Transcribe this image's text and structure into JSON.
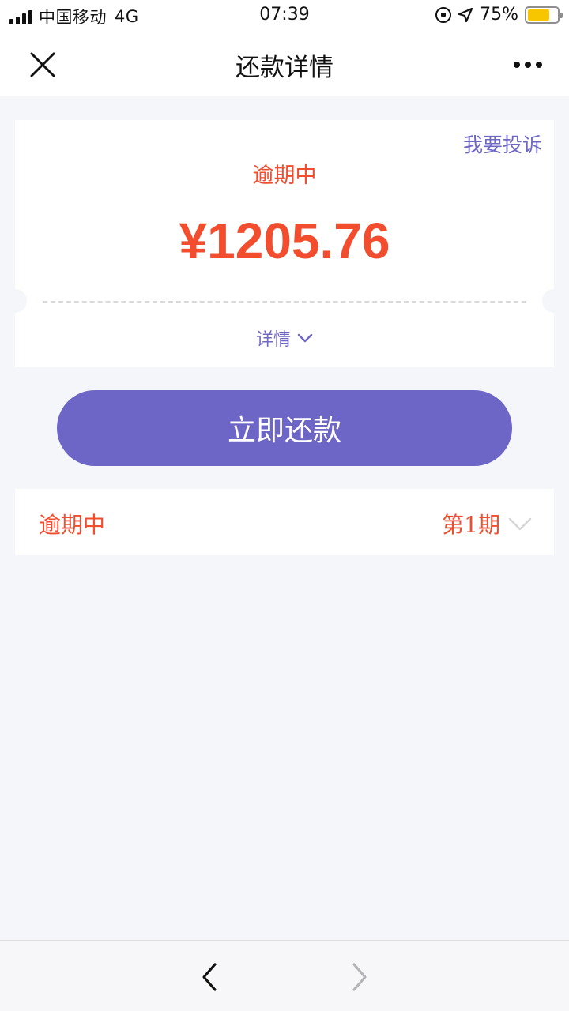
{
  "status_bar": {
    "carrier": "中国移动",
    "network": "4G",
    "time": "07:39",
    "battery_percent": "75%",
    "battery_level": 0.75,
    "icons": [
      "signal-icon",
      "orientation-lock-icon",
      "location-icon",
      "battery-icon"
    ]
  },
  "nav": {
    "title": "还款详情",
    "close_icon": "close-icon",
    "more_icon": "more-icon"
  },
  "summary": {
    "complaint_label": "我要投诉",
    "status": "逾期中",
    "amount": "¥1205.76",
    "details_label": "详情"
  },
  "actions": {
    "repay_label": "立即还款"
  },
  "installment": {
    "status": "逾期中",
    "period": "第1期"
  },
  "toolbar": {
    "back_icon": "chevron-left-icon",
    "forward_icon": "chevron-right-icon"
  },
  "colors": {
    "accent": "#6e66c6",
    "overdue": "#f14d2e",
    "background": "#f5f6fa",
    "battery": "#f7c600"
  }
}
